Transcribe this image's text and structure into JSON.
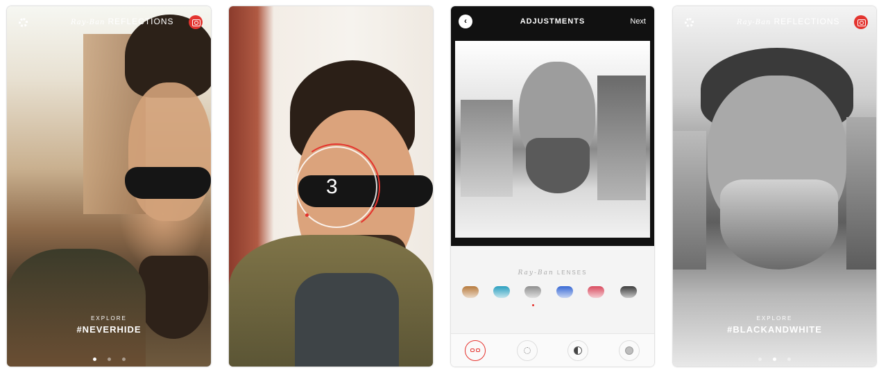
{
  "screens": [
    {
      "brand_script": "Ray-Ban",
      "brand": "REFLECTIONS",
      "explore": "EXPLORE",
      "hashtag": "#NEVERHIDE",
      "dots": 3,
      "active_dot": 0
    },
    {
      "countdown": "3"
    },
    {
      "title": "ADJUSTMENTS",
      "next": "Next",
      "lenses_script": "Ray-Ban",
      "lenses_label": "LENSES",
      "lens_colors": [
        "#b77a3c",
        "#2a9fbf",
        "#8e8e8e",
        "#3768d4",
        "#d94b5f",
        "#3b3b3b"
      ],
      "selected_lens": 2,
      "tools": [
        "glasses-icon",
        "brightness-icon",
        "contrast-icon",
        "saturation-icon"
      ],
      "selected_tool": 0
    },
    {
      "brand_script": "Ray-Ban",
      "brand": "REFLECTIONS",
      "explore": "EXPLORE",
      "hashtag": "#BLACKANDWHITE",
      "dots": 3,
      "active_dot": 1
    }
  ],
  "colors": {
    "accent": "#e5322d",
    "header": "#111111"
  }
}
